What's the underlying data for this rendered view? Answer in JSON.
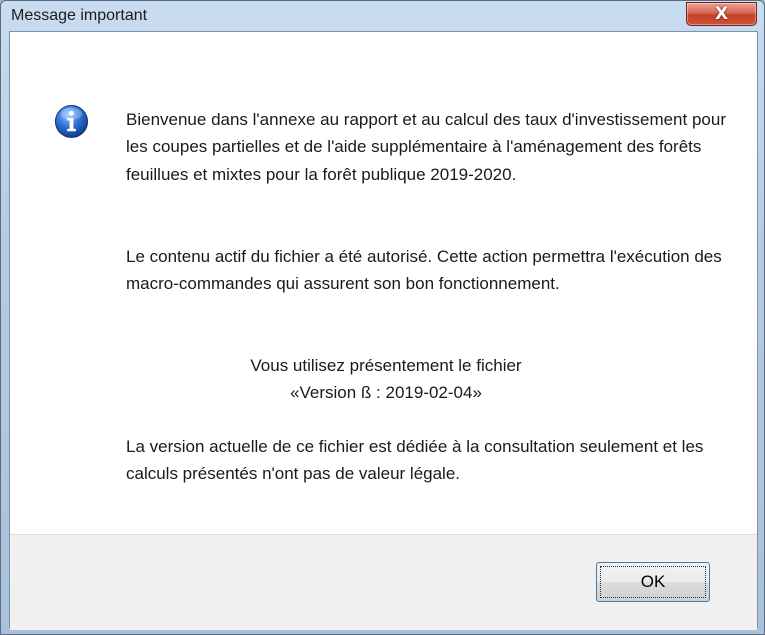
{
  "window": {
    "title": "Message important",
    "close_glyph": "X"
  },
  "message": {
    "icon": "info-icon",
    "paragraph1": "Bienvenue dans l'annexe au rapport et au calcul des taux d'investissement pour les coupes partielles et de l'aide supplémentaire à l'aménagement des forêts feuillues et mixtes pour la forêt publique 2019-2020.",
    "paragraph2": "Le contenu actif du fichier a été autorisé. Cette action permettra l'exécution des macro-commandes qui assurent son bon fonctionnement.",
    "version_intro": "Vous utilisez présentement le fichier",
    "version_value": "«Version ß : 2019-02-04»",
    "paragraph4": "La version actuelle de ce fichier est dédiée à la consultation seulement et les calculs présentés n'ont pas de valeur légale."
  },
  "buttons": {
    "ok_label": "OK"
  },
  "colors": {
    "accent_icon": "#1d5fbf",
    "close_button": "#c4412b",
    "focus_border": "#3c7fb1"
  }
}
